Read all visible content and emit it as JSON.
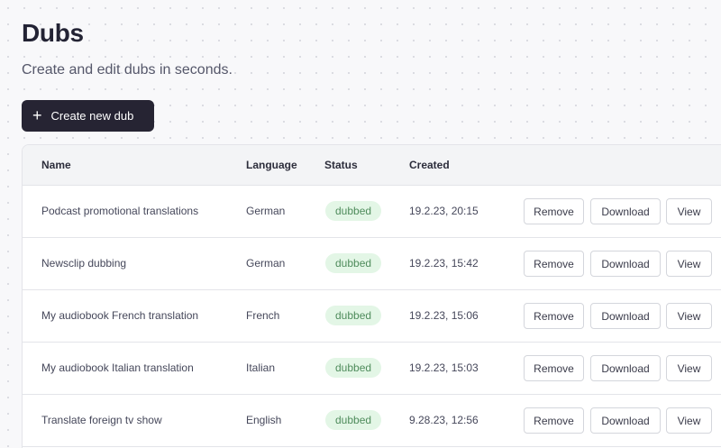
{
  "header": {
    "title": "Dubs",
    "subtitle": "Create and edit dubs in seconds.",
    "create_button_label": "Create new dub",
    "create_button_icon": "plus-icon"
  },
  "table": {
    "columns": {
      "name": "Name",
      "language": "Language",
      "status": "Status",
      "created": "Created"
    },
    "rows": [
      {
        "name": "Podcast promotional translations",
        "language": "German",
        "status": "dubbed",
        "created": "19.2.23, 20:15"
      },
      {
        "name": "Newsclip dubbing",
        "language": "German",
        "status": "dubbed",
        "created": "19.2.23, 15:42"
      },
      {
        "name": "My audiobook French translation",
        "language": "French",
        "status": "dubbed",
        "created": "19.2.23, 15:06"
      },
      {
        "name": "My audiobook Italian translation",
        "language": "Italian",
        "status": "dubbed",
        "created": "19.2.23, 15:03"
      },
      {
        "name": "Translate foreign tv show",
        "language": "English",
        "status": "dubbed",
        "created": "9.28.23, 12:56"
      }
    ],
    "actions": {
      "remove": "Remove",
      "download": "Download",
      "view": "View"
    }
  },
  "colors": {
    "primary_button": "#262433",
    "status_badge_bg": "#e3f6e6",
    "status_badge_text": "#4f8c5c"
  }
}
